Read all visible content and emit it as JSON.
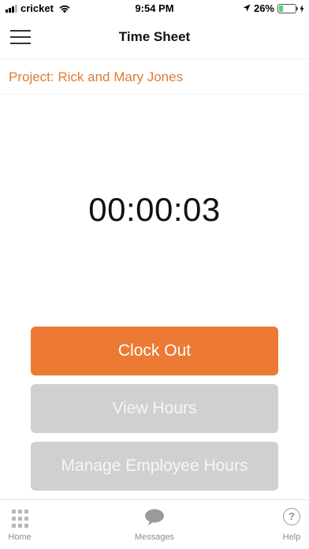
{
  "status_bar": {
    "carrier": "cricket",
    "time": "9:54 PM",
    "battery_percent": "26%",
    "battery_level": 0.26,
    "icons": [
      "signal-icon",
      "wifi-icon",
      "location-arrow-icon",
      "battery-icon",
      "charging-bolt-icon"
    ]
  },
  "nav": {
    "title": "Time Sheet",
    "menu_icon": "hamburger-menu-icon"
  },
  "project": {
    "label": "Project: Rick and Mary Jones"
  },
  "timer": {
    "elapsed": "00:00:03"
  },
  "actions": {
    "clock_out": "Clock Out",
    "view_hours": "View Hours",
    "manage_hours": "Manage Employee Hours"
  },
  "tab_bar": {
    "home": "Home",
    "messages": "Messages",
    "help": "Help",
    "help_glyph": "?"
  },
  "colors": {
    "accent": "#ec7a35",
    "project_text": "#e07c30",
    "disabled_button": "#d0d0d0",
    "battery_fill": "#4cd964"
  }
}
